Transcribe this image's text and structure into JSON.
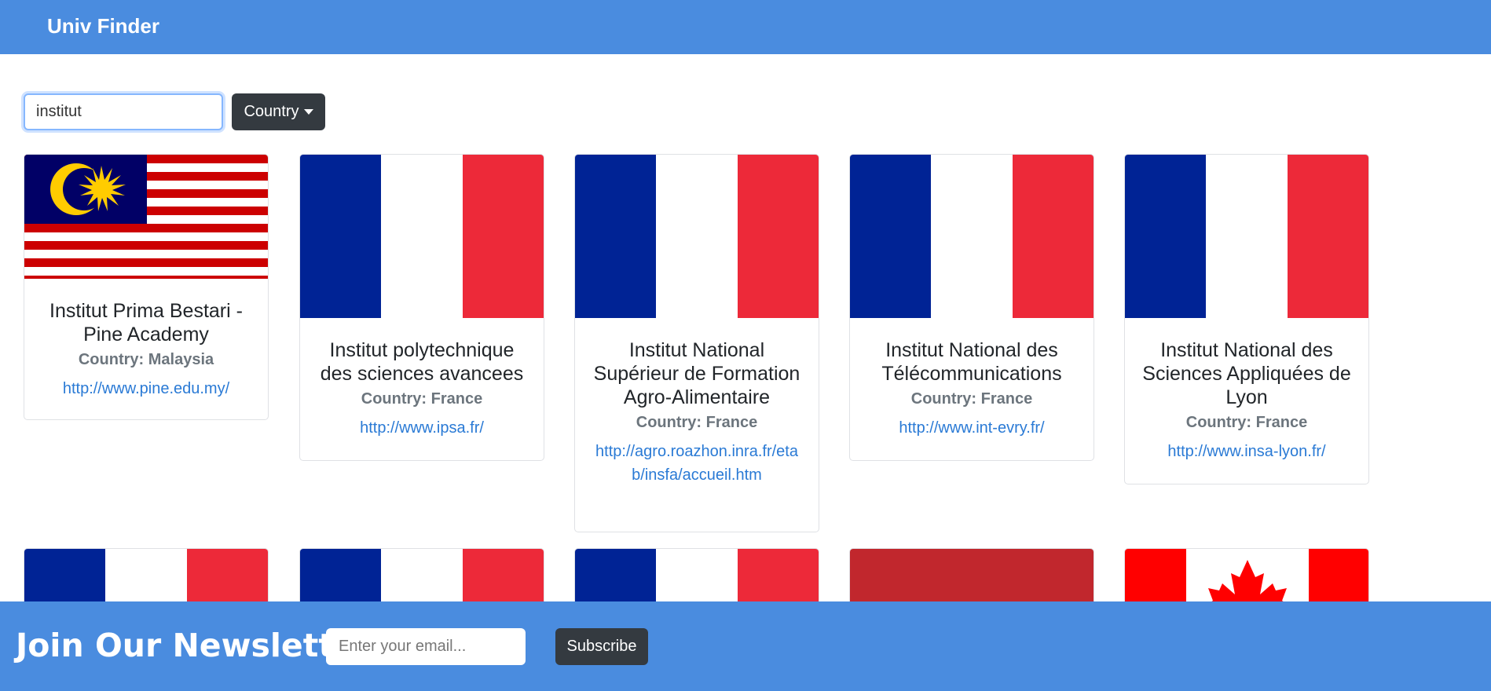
{
  "nav": {
    "brand": "Univ Finder"
  },
  "search": {
    "value": "institut",
    "country_label": "Country"
  },
  "cards": [
    {
      "name": "Institut Prima Bestari - Pine Academy",
      "country": "Country: Malaysia",
      "url": "http://www.pine.edu.my/",
      "flag": "malaysia-flag"
    },
    {
      "name": "Institut polytechnique des sciences avancees",
      "country": "Country: France",
      "url": "http://www.ipsa.fr/",
      "flag": "france-flag"
    },
    {
      "name": "Institut National Supérieur de Formation Agro-Alimentaire",
      "country": "Country: France",
      "url": "http://agro.roazhon.inra.fr/etab/insfa/accueil.htm",
      "flag": "france-flag"
    },
    {
      "name": "Institut National des Télécommunications",
      "country": "Country: France",
      "url": "http://www.int-evry.fr/",
      "flag": "france-flag"
    },
    {
      "name": "Institut National des Sciences Appliquées de Lyon",
      "country": "Country: France",
      "url": "http://www.insa-lyon.fr/",
      "flag": "france-flag"
    }
  ],
  "row2_flags": [
    "france-flag",
    "france-flag",
    "france-flag",
    "red-flag",
    "canada-flag"
  ],
  "footer": {
    "title": "Join Our Newsletter",
    "email_placeholder": "Enter your email...",
    "subscribe_label": "Subscribe"
  },
  "colors": {
    "brand_blue": "#4a8cdf",
    "dark_button": "#343a40",
    "link": "#2a7ad5",
    "france_blue": "#002395",
    "france_red": "#ed2939"
  }
}
